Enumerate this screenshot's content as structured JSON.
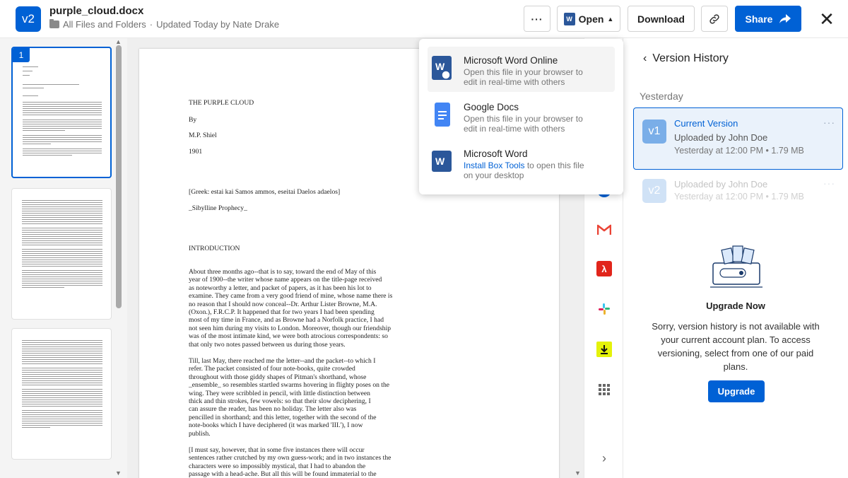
{
  "header": {
    "version_badge": "v2",
    "file_name": "purple_cloud.docx",
    "path": "All Files and Folders",
    "separator": "·",
    "updated": "Updated Today by Nate Drake",
    "more_label": "···",
    "open_label": "Open",
    "download_label": "Download",
    "share_label": "Share"
  },
  "thumbnails": {
    "selected_page": "1"
  },
  "document": {
    "title": "THE PURPLE CLOUD",
    "by": "By",
    "author": "M.P. Shiel",
    "year": "1901",
    "greek": "[Greek: estai kai Samos ammos, eseitai Daelos adaelos]",
    "prophecy": "_Sibylline Prophecy_",
    "intro_heading": "INTRODUCTION",
    "para1": [
      "About three months ago--that is to say, toward the end of May of this",
      "year of 1900--the writer whose name appears on the title-page received",
      "as noteworthy a letter, and packet of papers, as it has been his lot to",
      "examine. They came from a very good friend of mine, whose name there is",
      "no reason that I should now conceal--Dr. Arthur Lister Browne, M.A.",
      "(Oxon.), F.R.C.P. It happened that for two years I had been spending",
      "most of my time in France, and as Browne had a Norfolk practice, I had",
      "not seen him during my visits to London. Moreover, though our friendship",
      "was of the most intimate kind, we were both atrocious correspondents: so",
      "that only two notes passed between us during those years."
    ],
    "para2": [
      "Till, last May, there reached me the letter--and the packet--to which I",
      "refer. The packet consisted of four note-books, quite crowded",
      "throughout with those giddy shapes of Pitman's shorthand, whose",
      "_ensemble_ so resembles startled swarms hovering in flighty poses on the",
      "wing. They were scribbled in pencil, with little distinction between",
      "thick and thin strokes, few vowels: so that their slow deciphering, I",
      "can assure the reader, has been no holiday. The letter also was",
      "pencilled in shorthand; and this letter, together with the second of the",
      "note-books which I have deciphered (it was marked 'III.'), I now",
      "publish."
    ],
    "para3": [
      "[I must say, however, that in some five instances there will occur",
      "sentences rather crutched by my own guess-work; and in two instances the",
      "characters were so impossibly mystical, that I had to abandon the",
      "passage with a head-ache. But all this will be found immaterial to the"
    ]
  },
  "open_menu": {
    "items": [
      {
        "title": "Microsoft Word Online",
        "desc1": "Open this file in your browser to",
        "desc2": "edit in real-time with others"
      },
      {
        "title": "Google Docs",
        "desc1": "Open this file in your browser to",
        "desc2": "edit in real-time with others"
      },
      {
        "title": "Microsoft Word",
        "desc1_link": "Install Box Tools",
        "desc1_rest": " to open this file",
        "desc2": "on your desktop"
      }
    ]
  },
  "version_panel": {
    "title": "Version History",
    "section": "Yesterday",
    "versions": [
      {
        "badge": "v1",
        "label": "Current Version",
        "uploader": "Uploaded by John Doe",
        "meta": "Yesterday at 12:00 PM • 1.79 MB",
        "color": "#7aaee8"
      },
      {
        "badge": "v2",
        "label": "Uploaded by John Doe",
        "meta": "Yesterday at 12:00 PM • 1.79 MB",
        "color": "#7aaee8"
      }
    ],
    "upgrade_title": "Upgrade Now",
    "upgrade_message": "Sorry, version history is not available with your current account plan. To access versioning, select from one of our paid plans.",
    "upgrade_button": "Upgrade"
  },
  "integrations": [
    "microsoft-icon",
    "gmail-icon",
    "adobe-acrobat-icon",
    "slack-icon",
    "download-icon",
    "apps-grid-icon",
    "chevron-right-icon"
  ],
  "colors": {
    "primary": "#0061d5",
    "word_blue": "#2b579a",
    "docs_blue": "#4285f4"
  }
}
